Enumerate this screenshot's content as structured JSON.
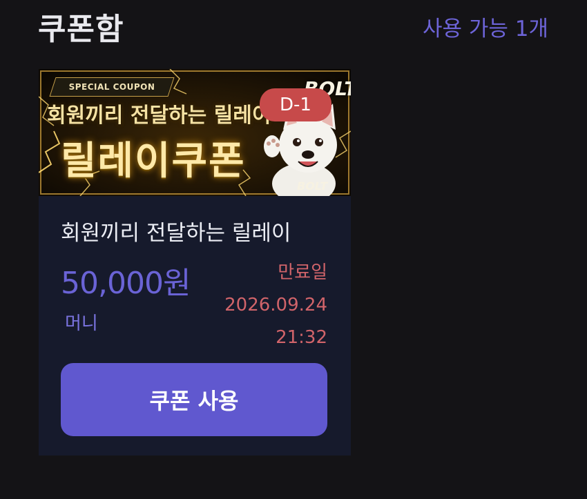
{
  "header": {
    "title": "쿠폰함",
    "available": "사용 가능 1개"
  },
  "coupon": {
    "banner": {
      "tag": "SPECIAL COUPON",
      "subtitle": "회원끼리 전달하는 릴레이",
      "title": "릴레이쿠폰",
      "brand": "BOLT",
      "brand_small": "BOLT",
      "mascot": "white-dog-mascot"
    },
    "dday": "D-1",
    "title": "회원끼리 전달하는 릴레이",
    "amount": "50,000원",
    "amount_type": "머니",
    "expiry_label": "만료일",
    "expiry_date": "2026.09.24",
    "expiry_time": "21:32",
    "use_button": "쿠폰 사용"
  },
  "colors": {
    "background": "#141316",
    "card": "#161a2c",
    "accent": "#6058cf",
    "expiry": "#d1646a",
    "badge": "#c74a4a"
  }
}
